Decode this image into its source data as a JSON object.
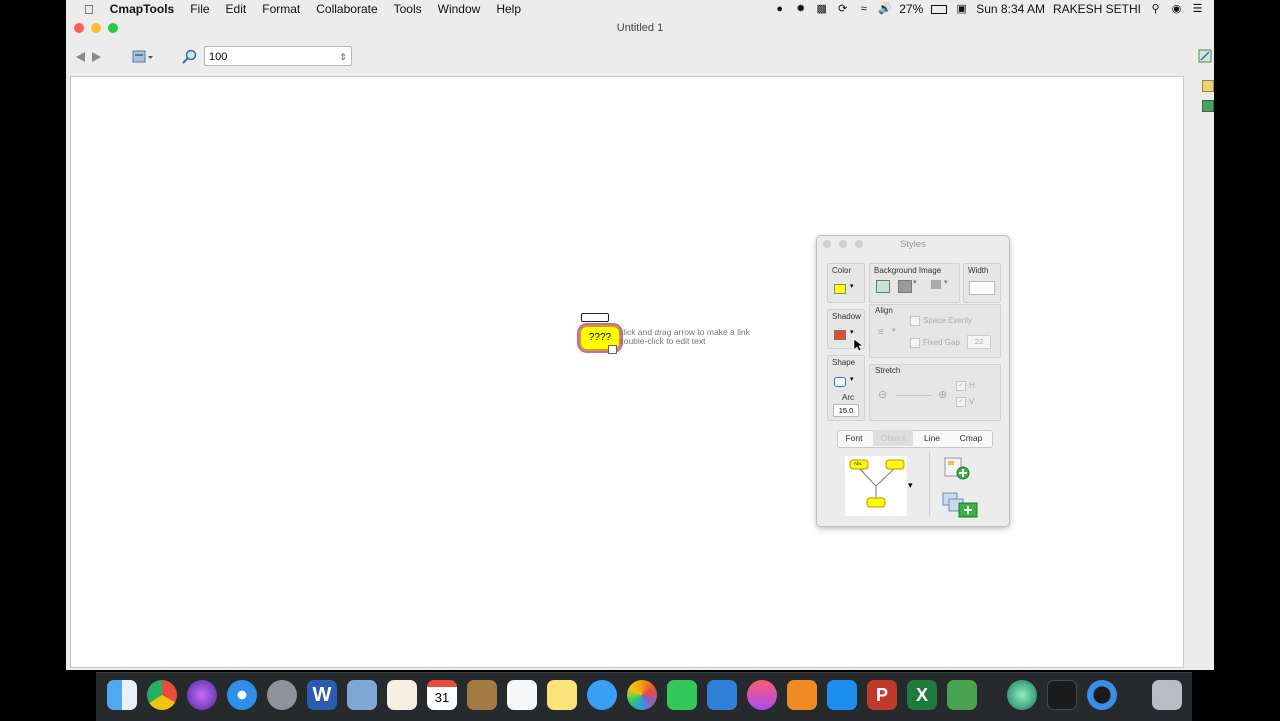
{
  "menubar": {
    "app_name": "CmapTools",
    "items": [
      "File",
      "Edit",
      "Format",
      "Collaborate",
      "Tools",
      "Window",
      "Help"
    ],
    "battery": "27%",
    "clock": "Sun 8:34 AM",
    "user": "RAKESH SETHI"
  },
  "window": {
    "title": "Untitled 1"
  },
  "toolbar": {
    "zoom_value": "100"
  },
  "canvas": {
    "concept_text": "????",
    "hint_line1": "click and drag arrow to make a link",
    "hint_line2": "double-click to edit text"
  },
  "styles_panel": {
    "title": "Styles",
    "color_label": "Color",
    "background_image_label": "Background Image",
    "width_label": "Width",
    "shadow_label": "Shadow",
    "align_label": "Align",
    "space_evenly_label": "Space Evenly",
    "fixed_gap_label": "Fixed Gap",
    "fixed_gap_value": "22",
    "shape_label": "Shape",
    "arc_label": "Arc",
    "arc_value": "15.0",
    "stretch_label": "Stretch",
    "h_label": "H",
    "v_label": "V",
    "tabs": {
      "font": "Font",
      "object": "Object",
      "line": "Line",
      "cmap": "Cmap"
    },
    "preview_node_label": "Abc"
  },
  "colors": {
    "concept_fill": "#ffff00",
    "concept_border": "#e19a00",
    "concept_halo": "#b06be0"
  }
}
